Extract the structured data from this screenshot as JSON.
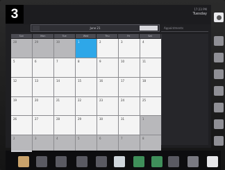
{
  "step": "3",
  "status": {
    "top": "17:23 PM",
    "bottom": "Tuesday"
  },
  "calendar": {
    "header_title": "June 21",
    "next_label": "",
    "side_title": "Appointments",
    "weekdays": [
      "Sun",
      "Mon",
      "Tue",
      "Wed",
      "Thu",
      "Fri",
      "Sat"
    ],
    "days": [
      {
        "n": "28",
        "t": "out"
      },
      {
        "n": "29",
        "t": "out"
      },
      {
        "n": "30",
        "t": "out"
      },
      {
        "n": "1",
        "t": "today"
      },
      {
        "n": "2",
        "t": "in"
      },
      {
        "n": "3",
        "t": "in"
      },
      {
        "n": "4",
        "t": "in"
      },
      {
        "n": "5",
        "t": "in"
      },
      {
        "n": "6",
        "t": "in"
      },
      {
        "n": "7",
        "t": "in"
      },
      {
        "n": "8",
        "t": "in"
      },
      {
        "n": "9",
        "t": "in"
      },
      {
        "n": "10",
        "t": "in"
      },
      {
        "n": "11",
        "t": "in"
      },
      {
        "n": "12",
        "t": "in"
      },
      {
        "n": "13",
        "t": "in"
      },
      {
        "n": "14",
        "t": "in"
      },
      {
        "n": "15",
        "t": "in"
      },
      {
        "n": "16",
        "t": "in"
      },
      {
        "n": "17",
        "t": "in"
      },
      {
        "n": "18",
        "t": "in"
      },
      {
        "n": "19",
        "t": "in"
      },
      {
        "n": "20",
        "t": "in"
      },
      {
        "n": "21",
        "t": "in"
      },
      {
        "n": "22",
        "t": "in"
      },
      {
        "n": "23",
        "t": "in"
      },
      {
        "n": "24",
        "t": "in"
      },
      {
        "n": "25",
        "t": "in"
      },
      {
        "n": "26",
        "t": "in"
      },
      {
        "n": "27",
        "t": "in"
      },
      {
        "n": "28",
        "t": "in"
      },
      {
        "n": "29",
        "t": "in"
      },
      {
        "n": "30",
        "t": "in"
      },
      {
        "n": "31",
        "t": "in"
      },
      {
        "n": "1",
        "t": "out"
      },
      {
        "n": "2",
        "t": "out"
      },
      {
        "n": "3",
        "t": "out"
      },
      {
        "n": "4",
        "t": "out"
      },
      {
        "n": "5",
        "t": "out"
      },
      {
        "n": "6",
        "t": "out"
      },
      {
        "n": "7",
        "t": "out"
      },
      {
        "n": "8",
        "t": "out"
      }
    ]
  },
  "rail": [
    {
      "name": "rail-button-1"
    },
    {
      "name": "rail-button-2"
    },
    {
      "name": "rail-button-3"
    },
    {
      "name": "rail-button-4"
    },
    {
      "name": "rail-button-5"
    },
    {
      "name": "rail-button-6"
    },
    {
      "name": "rail-button-7"
    },
    {
      "name": "rail-button-8"
    }
  ],
  "dock": [
    {
      "name": "dock-app-1",
      "color": "#c9a26b"
    },
    {
      "name": "dock-app-2",
      "color": "#5a5a62"
    },
    {
      "name": "dock-app-3",
      "color": "#5a5a62"
    },
    {
      "name": "dock-app-4",
      "color": "#5a5a62"
    },
    {
      "name": "dock-app-5",
      "color": "#5a5a62"
    },
    {
      "name": "dock-app-6",
      "color": "#cfd6dc"
    },
    {
      "name": "dock-app-7",
      "color": "#3f8f5a"
    },
    {
      "name": "dock-app-8",
      "color": "#3f8f5a"
    },
    {
      "name": "dock-app-9",
      "color": "#5a5a62"
    },
    {
      "name": "dock-app-10",
      "color": "#7a7a82"
    },
    {
      "name": "dock-app-11",
      "color": "#e6e6ea"
    }
  ],
  "colors": {
    "accent": "#2ea7e8",
    "out_of_month": "#b8b8bb",
    "cell": "#f4f4f4"
  }
}
